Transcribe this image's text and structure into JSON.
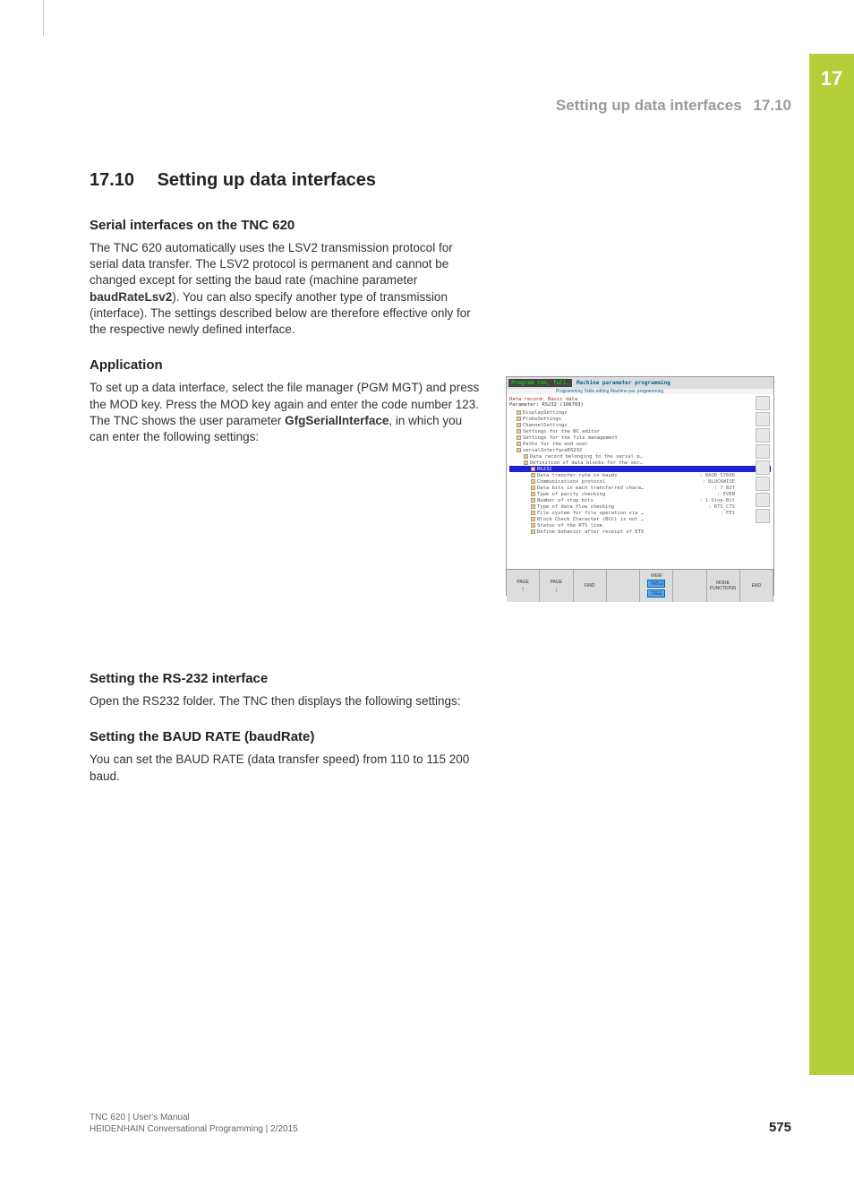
{
  "sideTab": "17",
  "runningHead": {
    "title": "Setting up data interfaces",
    "num": "17.10"
  },
  "section": {
    "num": "17.10",
    "title": "Setting up data interfaces"
  },
  "serial": {
    "heading": "Serial interfaces on the TNC 620",
    "p1a": "The TNC 620 automatically uses the LSV2 transmission protocol for serial data transfer. The LSV2 protocol is permanent and cannot be changed except for setting the baud rate (machine parameter ",
    "p1bold": "baudRateLsv2",
    "p1b": "). You can also specify another type of transmission (interface). The settings described below are therefore effective only for the respective newly defined interface."
  },
  "application": {
    "heading": "Application",
    "p1a": "To set up a data interface, select the file manager (PGM MGT) and press the MOD key. Press the MOD key again and enter the code number 123. The TNC shows the user parameter ",
    "p1bold": "GfgSerialInterface",
    "p1b": ", in which you can enter the following settings:"
  },
  "rs232": {
    "heading": "Setting the RS-232 interface",
    "p1": "Open the RS232 folder. The TNC then displays the following settings:"
  },
  "baud": {
    "heading": "Setting the BAUD RATE (baudRate)",
    "p1": "You can set the BAUD RATE (data transfer speed) from 110 to 115 200 baud."
  },
  "fig": {
    "mode1": "Program run, full.",
    "mode2": "Machine parameter programming",
    "sub": "Programming  Table editing  Machine par. programming",
    "hdr1": "Data record: Basic data",
    "hdr2": "Parameter:  RS232 (106703)",
    "tree": [
      {
        "t": "DisplaySettings",
        "i": 0
      },
      {
        "t": "ProbeSettings",
        "i": 0
      },
      {
        "t": "ChannelSettings",
        "i": 0
      },
      {
        "t": "Settings for the NC editor",
        "i": 0
      },
      {
        "t": "Settings for the file management",
        "i": 0
      },
      {
        "t": "Paths for the end user",
        "i": 0
      },
      {
        "t": "serialInterfaceRS232",
        "i": 0
      },
      {
        "t": "Data record belonging to the serial p…",
        "i": 1
      },
      {
        "t": "Definition of data blocks for the ser…",
        "i": 1
      },
      {
        "t": "RS232",
        "i": 2,
        "sel": true
      },
      {
        "t": "Data transfer rate in bauds",
        "v": ": BAUD_57600",
        "i": 2
      },
      {
        "t": "Communications protocol",
        "v": ": BLOCKWISE",
        "i": 2
      },
      {
        "t": "Data bits in each transferred chara…",
        "v": ": 7 BIT",
        "i": 2
      },
      {
        "t": "Type of parity checking",
        "v": ": EVEN",
        "i": 2
      },
      {
        "t": "Number of stop bits",
        "v": ": 1 Stop-Bit",
        "i": 2
      },
      {
        "t": "Type of data flow checking",
        "v": ": RTS_CTS",
        "i": 2
      },
      {
        "t": "File system for file operation via …",
        "v": ": FE1",
        "i": 2
      },
      {
        "t": "Block Check Character (BCC) is not …",
        "i": 2
      },
      {
        "t": "Status of the RTS line",
        "i": 2
      },
      {
        "t": "Define behavior after receipt of ETX",
        "i": 2
      }
    ],
    "softkeys": {
      "sk1": "PAGE",
      "sk2": "PAGE",
      "sk3": "FIND",
      "sk5a": "VIEW",
      "sk5b": "TABLE",
      "sk5c": "TREE",
      "sk7": "MORE FUNCTIONS",
      "sk8": "END"
    }
  },
  "footer": {
    "l1": "TNC 620 | User's Manual",
    "l2": "HEIDENHAIN Conversational Programming | 2/2015",
    "page": "575"
  }
}
